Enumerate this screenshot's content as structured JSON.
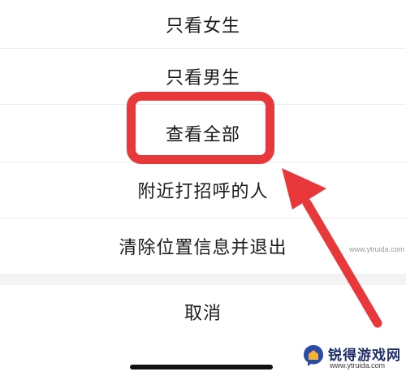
{
  "action_sheet": {
    "items": [
      {
        "label": "只看女生"
      },
      {
        "label": "只看男生"
      },
      {
        "label": "查看全部"
      },
      {
        "label": "附近打招呼的人"
      },
      {
        "label": "清除位置信息并退出"
      }
    ],
    "cancel_label": "取消"
  },
  "annotation": {
    "highlight_color": "#e8383c",
    "highlighted_item": "查看全部"
  },
  "watermark": {
    "brand": "锐得游戏网",
    "url": "www.ytruida.com",
    "url_top": "www.ytruida.com"
  }
}
